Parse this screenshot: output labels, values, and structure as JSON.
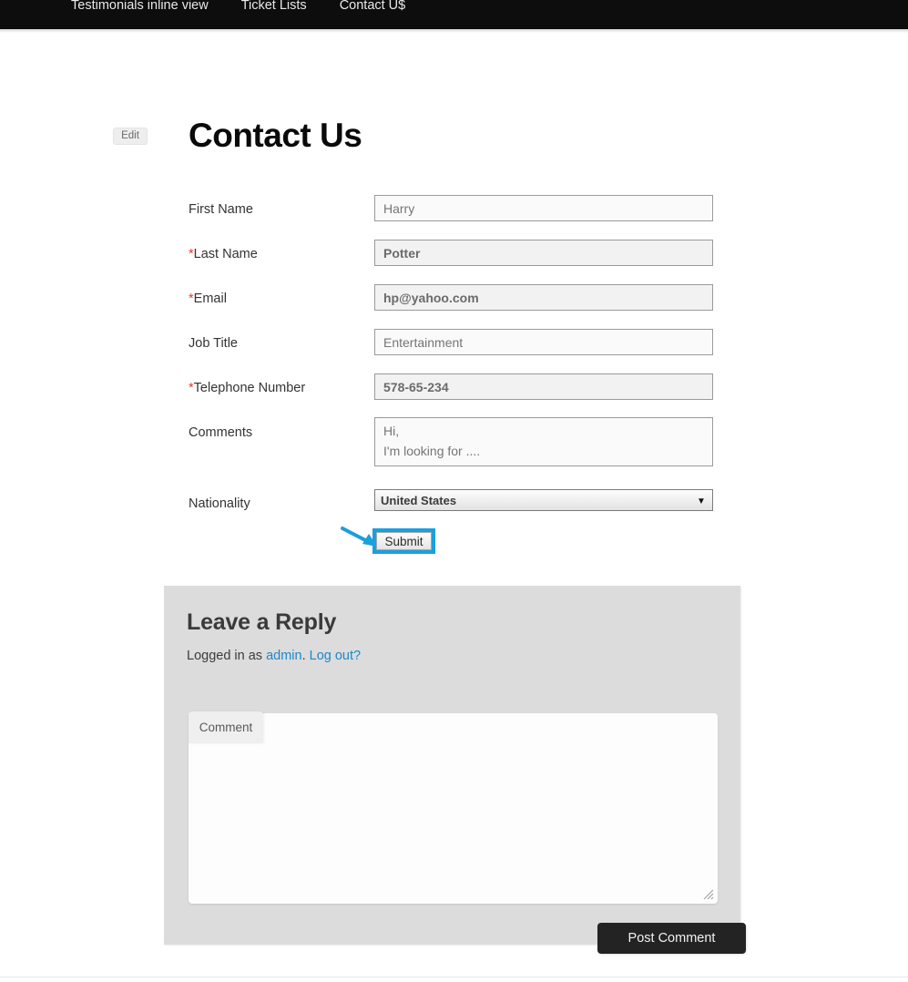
{
  "nav": {
    "items": [
      {
        "label": "Testimonials inline view"
      },
      {
        "label": "Ticket Lists"
      },
      {
        "label": "Contact U$"
      }
    ]
  },
  "header": {
    "edit_label": "Edit",
    "title": "Contact Us"
  },
  "form": {
    "fields": [
      {
        "label": "First Name",
        "required": false,
        "value": "Harry",
        "filled": false,
        "type": "text"
      },
      {
        "label": "Last Name",
        "required": true,
        "value": "Potter",
        "filled": true,
        "type": "text"
      },
      {
        "label": "Email",
        "required": true,
        "value": "hp@yahoo.com",
        "filled": true,
        "type": "text"
      },
      {
        "label": "Job Title",
        "required": false,
        "value": "Entertainment",
        "filled": false,
        "type": "text"
      },
      {
        "label": "Telephone Number",
        "required": true,
        "value": "578-65-234",
        "filled": true,
        "type": "text"
      },
      {
        "label": "Comments",
        "required": false,
        "value": "Hi,\nI'm looking for ....",
        "filled": false,
        "type": "textarea"
      },
      {
        "label": "Nationality",
        "required": false,
        "value": "United States",
        "filled": true,
        "type": "select"
      }
    ],
    "required_marker": "*",
    "nationality_options": [
      "United States"
    ],
    "submit_label": "Submit"
  },
  "annotation": {
    "highlight_color": "#1b9fdd",
    "arrow_color": "#1b9fdd",
    "target": "Submit"
  },
  "reply": {
    "title": "Leave a Reply",
    "logged_in_prefix": "Logged in as ",
    "user": "admin",
    "separator": ". ",
    "logout_label": "Log out?",
    "comment_label": "Comment",
    "comment_value": "",
    "post_label": "Post Comment"
  }
}
